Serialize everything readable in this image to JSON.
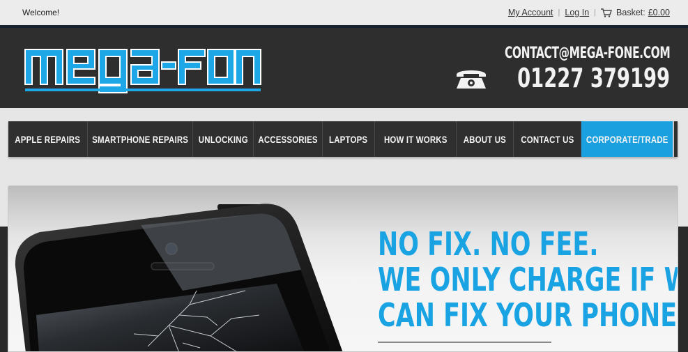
{
  "topbar": {
    "welcome": "Welcome!",
    "my_account": "My Account",
    "log_in": "Log In",
    "basket_label": "Basket:",
    "basket_total": "£0.00",
    "separator": "|"
  },
  "header": {
    "logo_text": "mega-fone",
    "email": "CONTACT@MEGA-FONE.COM",
    "phone": "01227 379199"
  },
  "nav": {
    "items": [
      {
        "label": "Apple Repairs"
      },
      {
        "label": "Smartphone Repairs"
      },
      {
        "label": "Unlocking"
      },
      {
        "label": "Accessories"
      },
      {
        "label": "Laptops"
      },
      {
        "label": "How It Works"
      },
      {
        "label": "About Us"
      },
      {
        "label": "Contact Us"
      },
      {
        "label": "Corporate/Trade",
        "active": true
      }
    ]
  },
  "hero": {
    "headline_lines": [
      "NO FIX. NO FEE.",
      "WE ONLY CHARGE IF WE",
      "CAN FIX YOUR PHONE"
    ]
  },
  "colors": {
    "accent": "#1aa0df",
    "header_bg": "#2e2e2e",
    "nav_bg": "#2f2f2f",
    "headline": "#19a3e3"
  },
  "icons": {
    "cart": "shopping-cart-icon",
    "phone": "telephone-icon"
  }
}
